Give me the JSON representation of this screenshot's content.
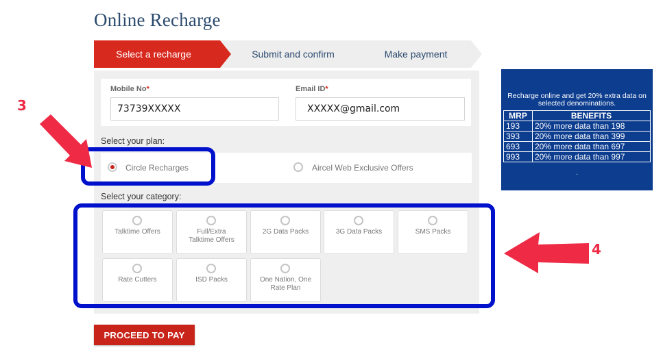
{
  "page": {
    "title": "Online Recharge"
  },
  "steps": [
    {
      "label": "Select a recharge",
      "active": true
    },
    {
      "label": "Submit and confirm",
      "active": false
    },
    {
      "label": "Make payment",
      "active": false
    }
  ],
  "form": {
    "mobile": {
      "label": "Mobile No",
      "required_mark": "*",
      "value": "73739XXXXX"
    },
    "email": {
      "label": "Email ID",
      "required_mark": "*",
      "value": "XXXXX@gmail.com"
    }
  },
  "plan": {
    "section_label": "Select your plan:",
    "options": [
      {
        "label": "Circle Recharges",
        "selected": true
      },
      {
        "label": "Aircel Web Exclusive Offers",
        "selected": false
      }
    ]
  },
  "category": {
    "section_label": "Select your category:",
    "options": [
      {
        "label": "Talktime Offers"
      },
      {
        "label": "Full/Extra Talktime Offers"
      },
      {
        "label": "2G Data Packs"
      },
      {
        "label": "3G Data Packs"
      },
      {
        "label": "SMS Packs"
      },
      {
        "label": "Rate Cutters"
      },
      {
        "label": "ISD Packs"
      },
      {
        "label": "One Nation, One Rate Plan"
      }
    ]
  },
  "actions": {
    "proceed_label": "PROCEED TO PAY"
  },
  "annotations": {
    "plan_step": "3",
    "category_step": "4",
    "highlight_color": "#0011cc",
    "arrow_color": "#ee2a45"
  },
  "promo": {
    "headline": "Recharge online and get 20% extra data on selected denominations.",
    "columns": [
      "MRP",
      "BENEFITS"
    ],
    "rows": [
      {
        "mrp": "193",
        "benefit": "20% more data than 198"
      },
      {
        "mrp": "393",
        "benefit": "20% more data than 399"
      },
      {
        "mrp": "693",
        "benefit": "20% more data than 697"
      },
      {
        "mrp": "993",
        "benefit": "20% more data than 997"
      }
    ],
    "footer": ".",
    "background": "#0d3d8f"
  },
  "colors": {
    "brand_red": "#d8291e",
    "title_blue": "#2b4a6e",
    "panel_gray": "#efefef"
  }
}
